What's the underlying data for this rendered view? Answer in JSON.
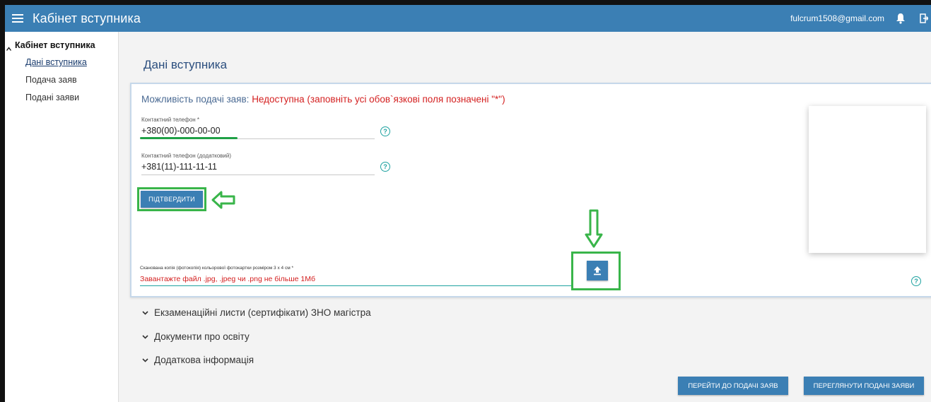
{
  "header": {
    "title": "Кабінет вступника",
    "user_email": "fulcrum1508@gmail.com"
  },
  "sidebar": {
    "section_title": "Кабінет вступника",
    "items": [
      {
        "label": "Дані вступника",
        "active": true
      },
      {
        "label": "Подача заяв",
        "active": false
      },
      {
        "label": "Подані заяви",
        "active": false
      }
    ]
  },
  "main": {
    "page_title": "Дані вступника",
    "availability_label": "Можливість подачі заяв:",
    "availability_value": "Недоступна (заповніть усі обов`язкові поля позначені \"*\")",
    "phone": {
      "label": "Контактний телефон *",
      "value": "+380(00)-000-00-00"
    },
    "phone_extra": {
      "label": "Контактний телефон (додатковий)",
      "value": "+381(11)-111-11-11"
    },
    "confirm_label": "ПІДТВЕРДИТИ",
    "photo": {
      "label": "Сканована копія (фотокопія) кольорової фотокартки розміром 3 х 4 см *",
      "hint": "Завантажте файл .jpg, .jpeg чи .png не більше 1Мб"
    },
    "help_glyph": "?",
    "accordions": [
      "Екзаменаційні листи (сертифікати) ЗНО магістра",
      "Документи про освіту",
      "Додаткова інформація"
    ],
    "go_to_apply_label": "ПЕРЕЙТИ ДО ПОДАЧІ ЗАЯВ",
    "view_applications_label": "ПЕРЕГЛЯНУТИ ПОДАНІ ЗАЯВИ"
  },
  "colors": {
    "brand": "#3b7fb4",
    "error": "#d42020",
    "highlight_green": "#39b54a",
    "help_teal": "#1ea2a0"
  },
  "icons": [
    "menu-icon",
    "bell-icon",
    "logout-icon",
    "help-icon",
    "upload-icon",
    "chevron-down-icon",
    "caret-up-icon"
  ]
}
